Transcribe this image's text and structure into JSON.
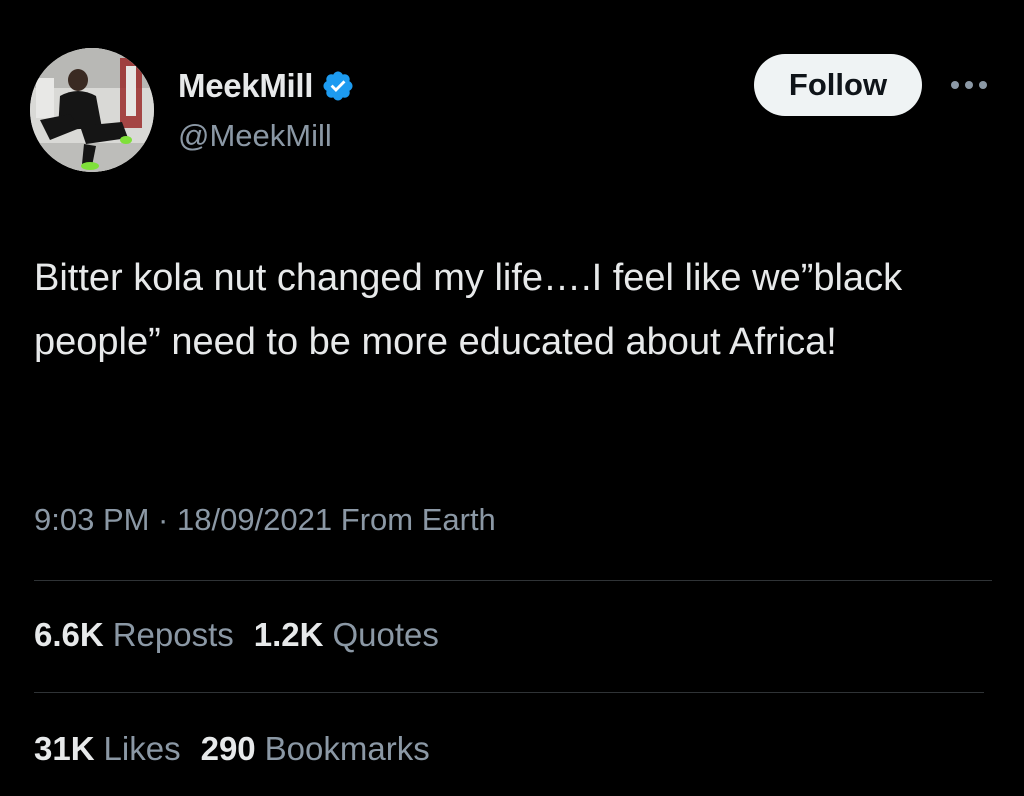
{
  "author": {
    "display_name": "MeekMill",
    "handle": "@MeekMill",
    "verified": true,
    "avatar_icon": "profile-photo",
    "verified_color": "#1d9bf0"
  },
  "actions": {
    "follow_label": "Follow",
    "more_icon": "more-horizontal-icon"
  },
  "tweet": {
    "text": "Bitter kola nut changed my life….I feel like we”black people” need to be more educated about Africa!",
    "meta": "9:03 PM · 18/09/2021 From Earth"
  },
  "stats": {
    "reposts": {
      "count": "6.6K",
      "label": "Reposts"
    },
    "quotes": {
      "count": "1.2K",
      "label": "Quotes"
    },
    "likes": {
      "count": "31K",
      "label": "Likes"
    },
    "bookmarks": {
      "count": "290",
      "label": "Bookmarks"
    }
  },
  "colors": {
    "background": "#000000",
    "primary_text": "#e7e9ea",
    "secondary_text": "#8b98a5",
    "divider": "#2f3336",
    "follow_button_bg": "#eff3f4"
  }
}
